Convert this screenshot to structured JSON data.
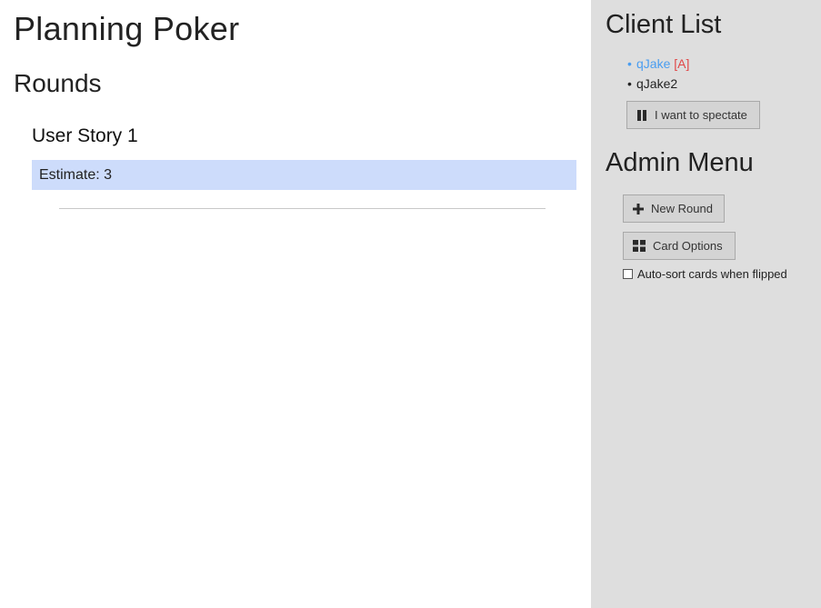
{
  "app": {
    "title": "Planning Poker"
  },
  "main": {
    "section_title": "Rounds",
    "rounds": [
      {
        "title": "User Story 1",
        "estimate_label": "Estimate: 3"
      }
    ]
  },
  "sidebar": {
    "client_list": {
      "heading": "Client List",
      "clients": [
        {
          "bullet": "•",
          "name": "qJake",
          "tag": "[A]"
        },
        {
          "bullet": "•",
          "name": "qJake2"
        }
      ],
      "spectate_button": {
        "label": "I want to spectate",
        "icon": "pause-icon"
      }
    },
    "admin_menu": {
      "heading": "Admin Menu",
      "new_round_button": {
        "label": "New Round",
        "icon": "plus-icon"
      },
      "card_options_button": {
        "label": "Card Options",
        "icon": "grid-icon"
      },
      "auto_sort_checkbox": {
        "label": "Auto-sort cards when flipped",
        "checked": false
      }
    }
  },
  "colors": {
    "sidebar_bg": "#dedede",
    "estimate_bg": "#cddcfb",
    "self_client": "#4a9df0",
    "admin_tag": "#e04848"
  }
}
